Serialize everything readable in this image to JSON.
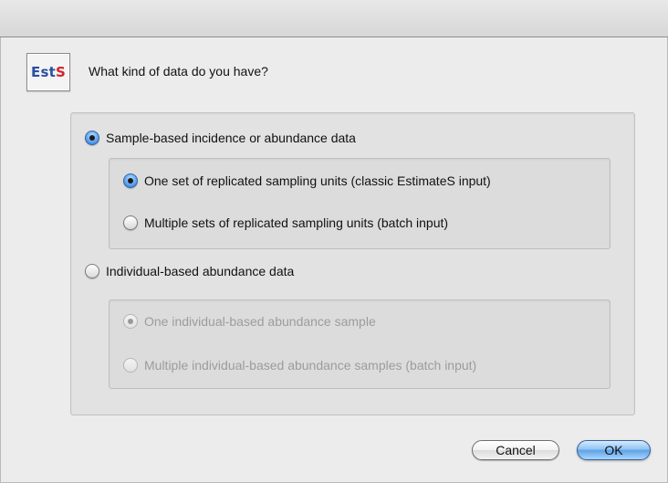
{
  "dialog": {
    "icon_text_est": "Est",
    "icon_text_s": "S",
    "prompt": "What kind of data do you have?"
  },
  "options": {
    "sample_based": {
      "label": "Sample-based incidence or abundance data",
      "selected": true,
      "sub": [
        {
          "label": "One set of replicated sampling units (classic EstimateS input)",
          "selected": true,
          "enabled": true
        },
        {
          "label": "Multiple sets of replicated sampling units (batch input)",
          "selected": false,
          "enabled": true
        }
      ]
    },
    "individual_based": {
      "label": "Individual-based abundance data",
      "selected": false,
      "sub": [
        {
          "label": "One individual-based abundance sample",
          "selected": true,
          "enabled": false
        },
        {
          "label": "Multiple individual-based abundance samples (batch input)",
          "selected": false,
          "enabled": false
        }
      ]
    }
  },
  "buttons": {
    "cancel": "Cancel",
    "ok": "OK"
  },
  "colors": {
    "accent": "#5fa2e6",
    "logo_blue": "#2a4fa0",
    "logo_red": "#d2232a"
  }
}
